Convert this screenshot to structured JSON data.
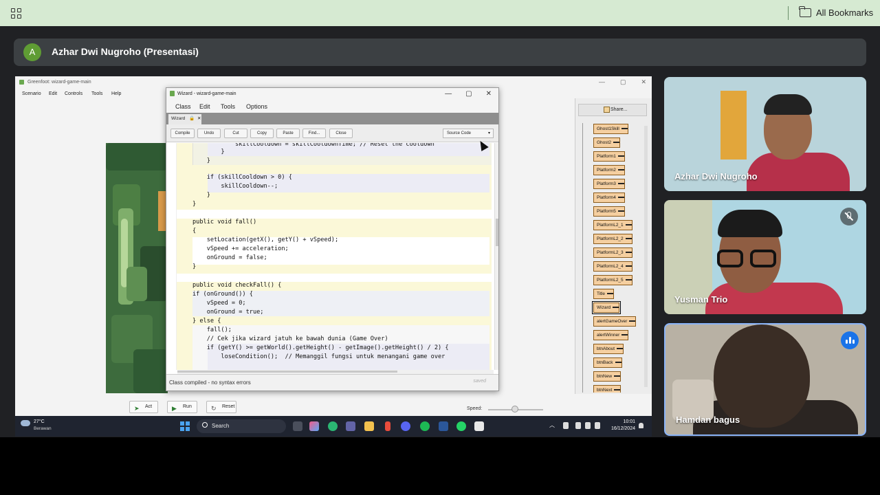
{
  "browser": {
    "bookmarks_label": "All Bookmarks"
  },
  "meet": {
    "presenter": {
      "avatar_letter": "A",
      "title": "Azhar Dwi Nugroho (Presentasi)"
    },
    "participants": [
      {
        "name": "Azhar Dwi Nugroho",
        "muted": false,
        "speaking": false
      },
      {
        "name": "Yusman Trio",
        "muted": true,
        "speaking": false
      },
      {
        "name": "Hamdan bagus",
        "muted": false,
        "speaking": true
      }
    ]
  },
  "greenfoot": {
    "window_title": "Greenfoot: wizard-game-main",
    "window_controls": [
      "—",
      "▢",
      "✕"
    ],
    "menu": [
      "Scenario",
      "Edit",
      "Controls",
      "Tools",
      "Help"
    ],
    "share_label": "Share...",
    "buttons": {
      "act": "Act",
      "run": "Run",
      "reset": "Reset"
    },
    "speed_label": "Speed:",
    "classes": [
      "Ghost1Skill",
      "Ghost2",
      "Platform1",
      "Platform2",
      "Platform3",
      "Platform4",
      "Platform5",
      "PlatformL2_1",
      "PlatformL2_2",
      "PlatformL2_3",
      "PlatformL2_4",
      "PlatformL2_5",
      "Title",
      "Wizard",
      "alertGameOver",
      "alertWinner",
      "btnAbout",
      "btnBack",
      "btnNew",
      "btnNext",
      "btnQuit"
    ],
    "selected_class": "Wizard"
  },
  "editor": {
    "window_title": "Wizard - wizard-game-main",
    "window_controls": [
      "—",
      "▢",
      "✕"
    ],
    "menu": [
      "Class",
      "Edit",
      "Tools",
      "Options"
    ],
    "tab_label": "Wizard",
    "toolbar": [
      "Compile",
      "Undo",
      "Cut",
      "Copy",
      "Paste",
      "Find...",
      "Close"
    ],
    "view_select": "Source Code",
    "code_lines": [
      "            skillCooldown = skillCooldownTime; // Reset the cooldown",
      "        }",
      "    }",
      "",
      "    if (skillCooldown > 0) {",
      "        skillCooldown--;",
      "    }",
      "}",
      "",
      "public void fall()",
      "{",
      "    setLocation(getX(), getY() + vSpeed);",
      "    vSpeed += acceleration;",
      "    onGround = false;",
      "}",
      "",
      "public void checkFall() {",
      "if (onGround()) {",
      "    vSpeed = 0;",
      "    onGround = true;",
      "} else {",
      "    fall();",
      "    // Cek jika wizard jatuh ke bawah dunia (Game Over)",
      "    if (getY() >= getWorld().getHeight() - getImage().getHeight() / 2) {",
      "        loseCondition();  // Memanggil fungsi untuk menangani game over"
    ],
    "status": "Class compiled - no syntax errors",
    "saved": "saved"
  },
  "taskbar": {
    "weather_temp": "27°C",
    "weather_desc": "Berawan",
    "search_label": "Search",
    "time": "10:01",
    "date": "16/12/2024"
  }
}
